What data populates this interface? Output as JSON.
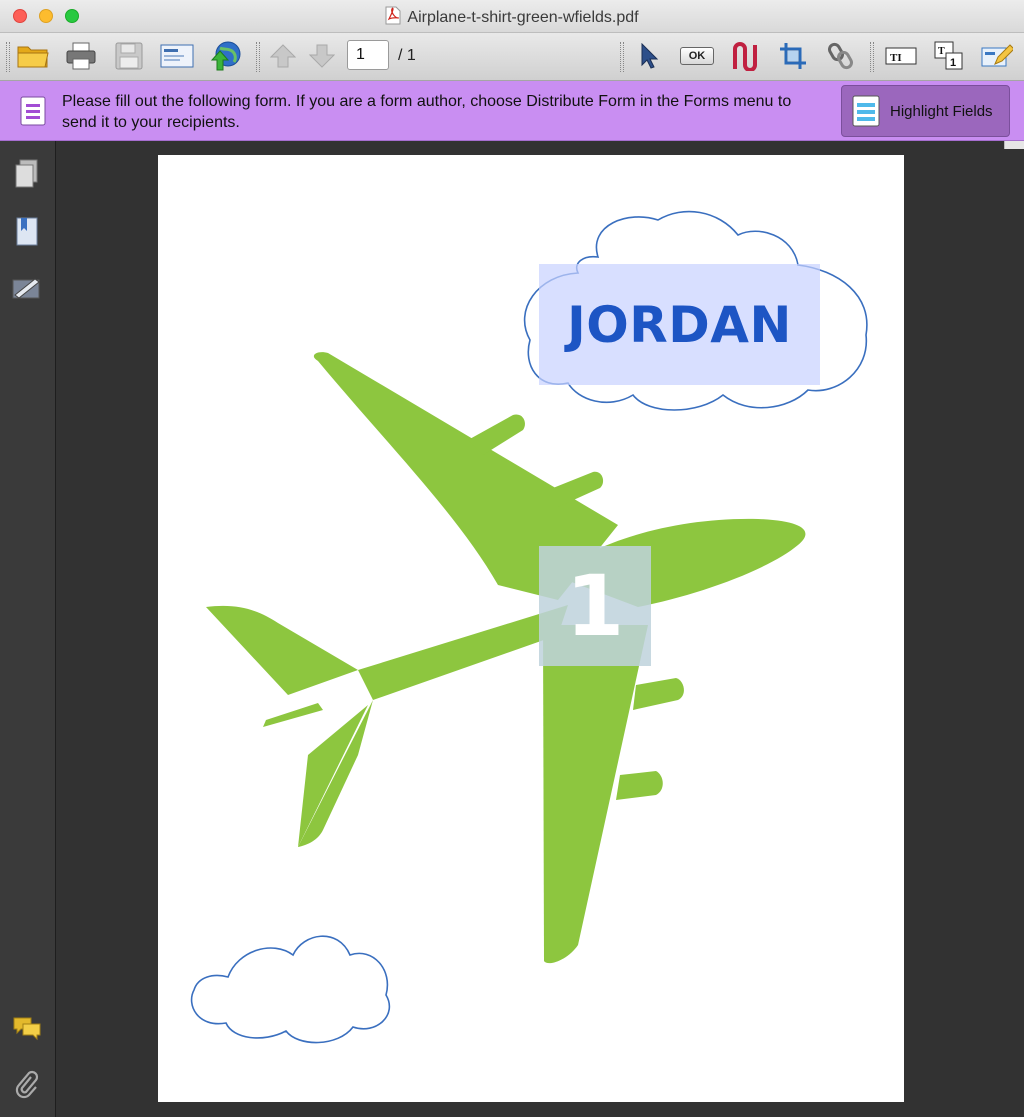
{
  "window": {
    "title": "Airplane-t-shirt-green-wfields.pdf"
  },
  "toolbar": {
    "page_current": "1",
    "page_total": "/ 1",
    "ok_label": "OK"
  },
  "formbar": {
    "message": "Please fill out the following form. If you are a form author, choose Distribute Form in the Forms menu to send it to your recipients.",
    "highlight_label": "Highlight Fields"
  },
  "document": {
    "name_field": "JORDAN",
    "number_field": "1"
  },
  "colors": {
    "airplane": "#8dc63f",
    "cloud_stroke": "#3a6fbf",
    "form_bar": "#c98ef2",
    "name_text": "#1d55c4"
  }
}
